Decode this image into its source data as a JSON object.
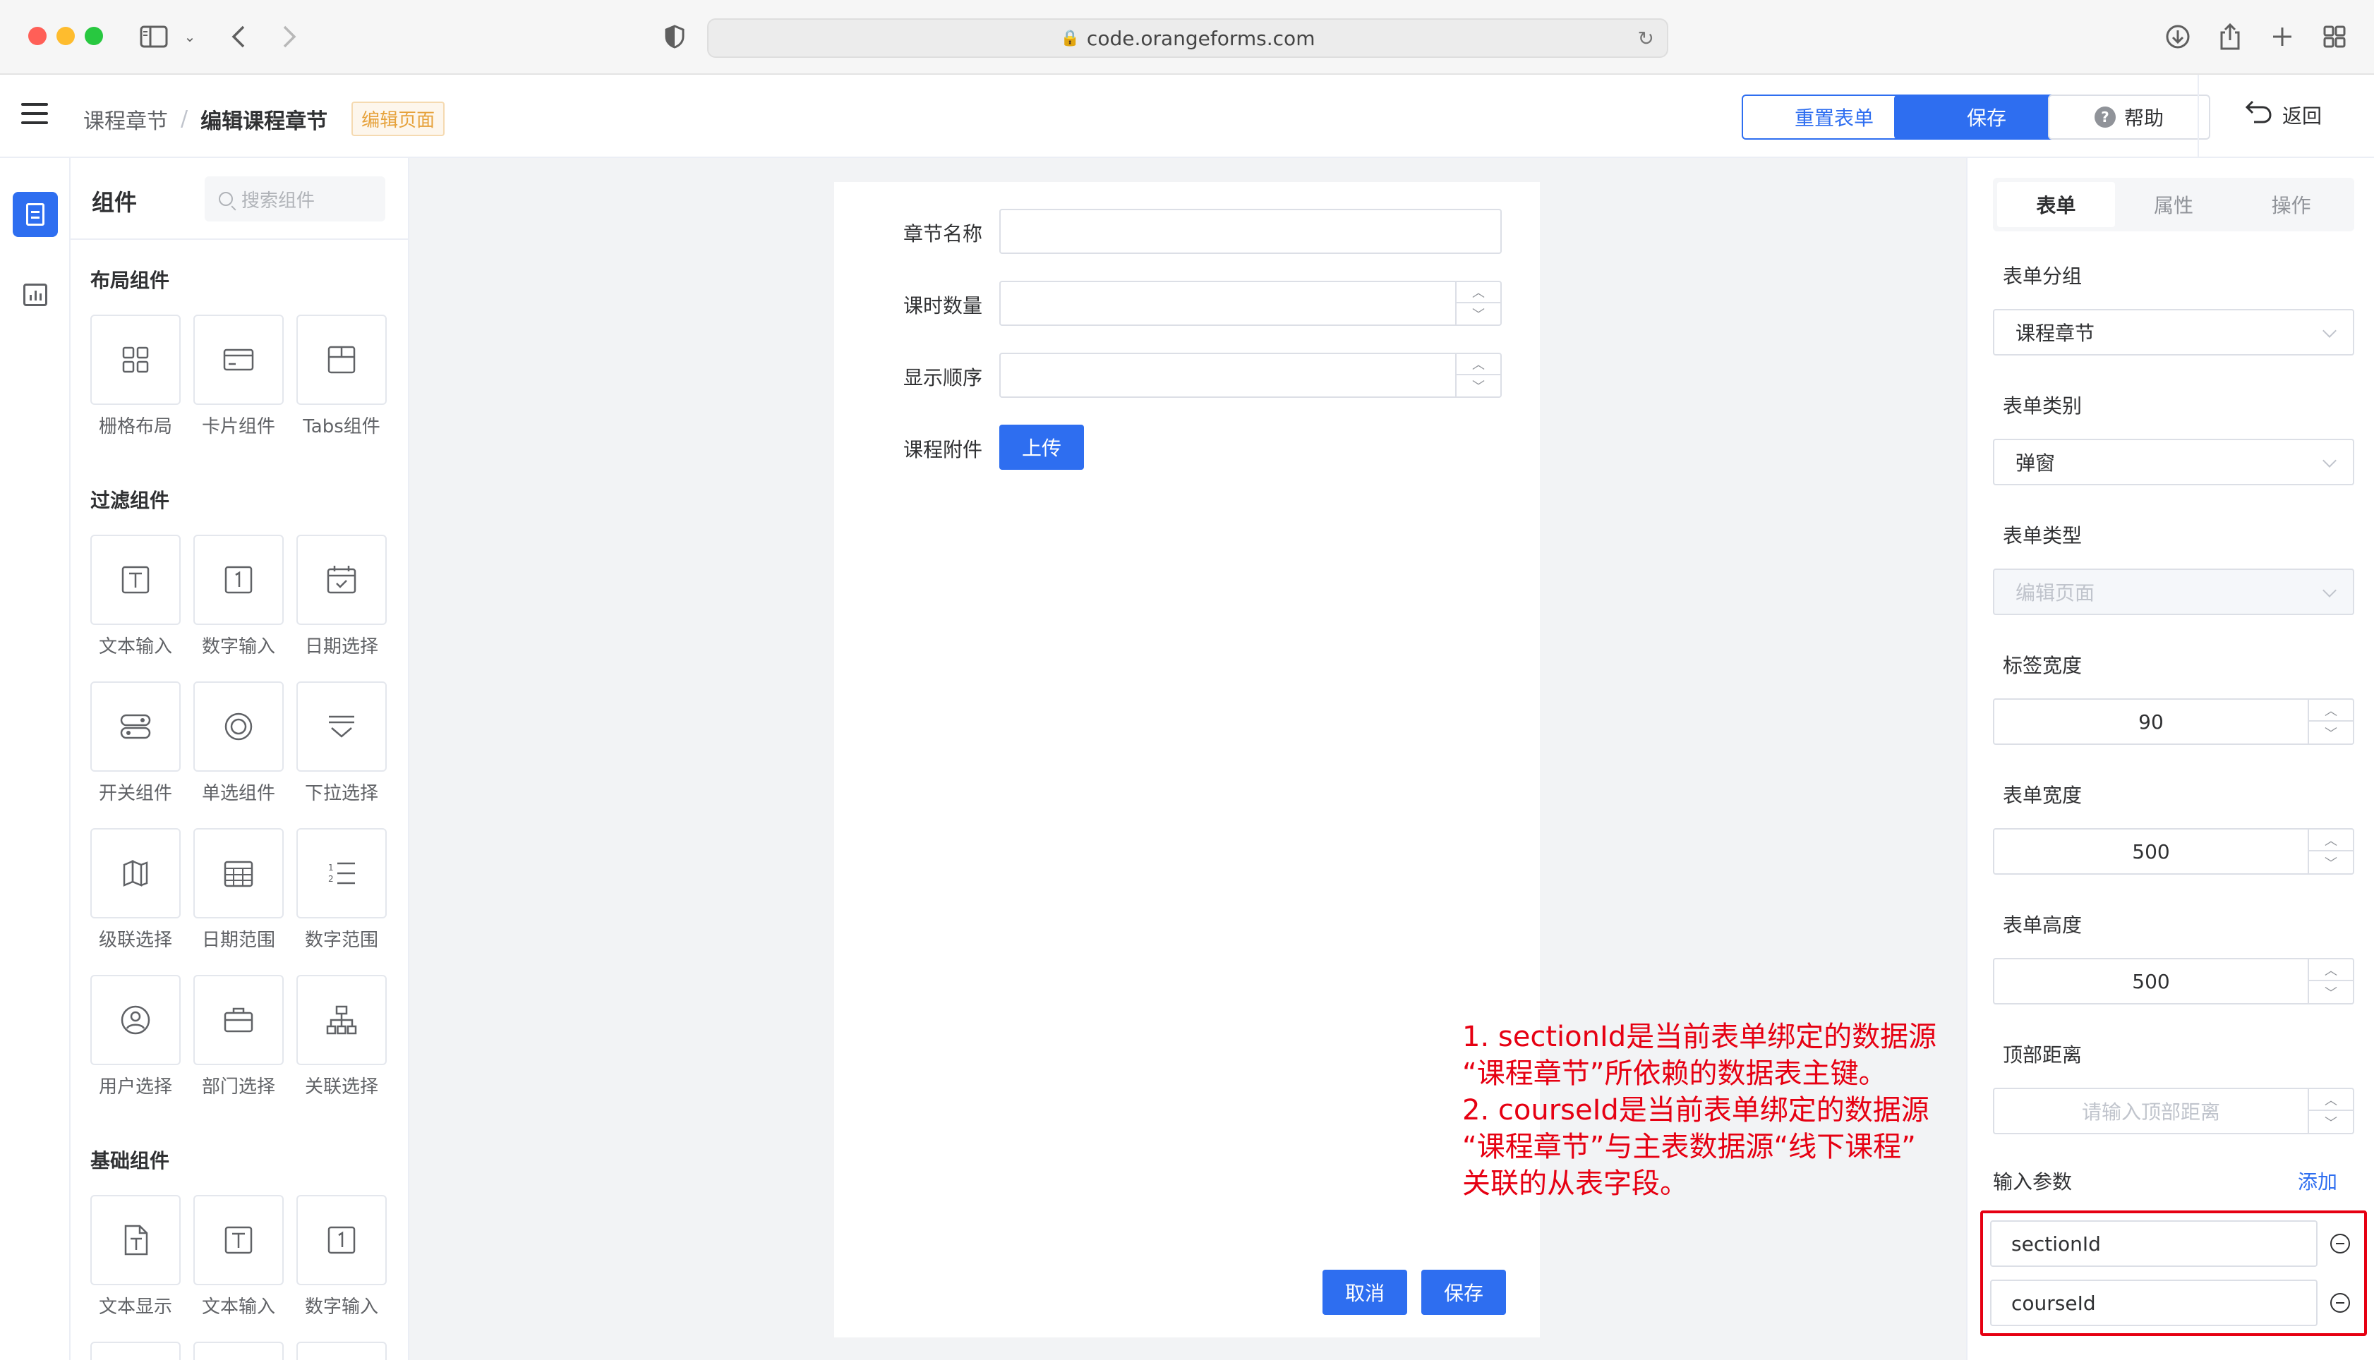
{
  "browser": {
    "url": "code.orangeforms.com"
  },
  "header": {
    "breadcrumb_parent": "课程章节",
    "breadcrumb_sep": "/",
    "breadcrumb_current": "编辑课程章节",
    "page_tag": "编辑页面",
    "reset_label": "重置表单",
    "save_label": "保存",
    "help_label": "帮助",
    "back_label": "返回"
  },
  "components": {
    "title": "组件",
    "search_placeholder": "搜索组件",
    "groups": [
      {
        "title": "布局组件",
        "items": [
          "栅格布局",
          "卡片组件",
          "Tabs组件"
        ]
      },
      {
        "title": "过滤组件",
        "items": [
          "文本输入",
          "数字输入",
          "日期选择",
          "开关组件",
          "单选组件",
          "下拉选择",
          "级联选择",
          "日期范围",
          "数字范围",
          "用户选择",
          "部门选择",
          "关联选择"
        ]
      },
      {
        "title": "基础组件",
        "items": [
          "文本显示",
          "文本输入",
          "数字输入"
        ]
      }
    ]
  },
  "form": {
    "fields": [
      {
        "label": "章节名称"
      },
      {
        "label": "课时数量"
      },
      {
        "label": "显示顺序"
      },
      {
        "label": "课程附件"
      }
    ],
    "upload_label": "上传",
    "cancel_label": "取消",
    "save_label": "保存"
  },
  "annotation": {
    "line1": "1. sectionId是当前表单绑定的数据源",
    "line2": "“课程章节”所依赖的数据表主键。",
    "line3": "2. courseId是当前表单绑定的数据源",
    "line4": "“课程章节”与主表数据源“线下课程”",
    "line5": "关联的从表字段。"
  },
  "properties": {
    "tabs": [
      "表单",
      "属性",
      "操作"
    ],
    "active_tab": "表单",
    "form_group_label": "表单分组",
    "form_group_value": "课程章节",
    "form_kind_label": "表单类别",
    "form_kind_value": "弹窗",
    "form_type_label": "表单类型",
    "form_type_value": "编辑页面",
    "label_width_label": "标签宽度",
    "label_width_value": "90",
    "form_width_label": "表单宽度",
    "form_width_value": "500",
    "form_height_label": "表单高度",
    "form_height_value": "500",
    "top_distance_label": "顶部距离",
    "top_distance_placeholder": "请输入顶部距离",
    "params_label": "输入参数",
    "params_add": "添加",
    "params": [
      "sectionId",
      "courseId"
    ]
  },
  "colors": {
    "primary": "#2e6ef0",
    "annotation": "#e60012",
    "tag": "#e6a23c"
  }
}
